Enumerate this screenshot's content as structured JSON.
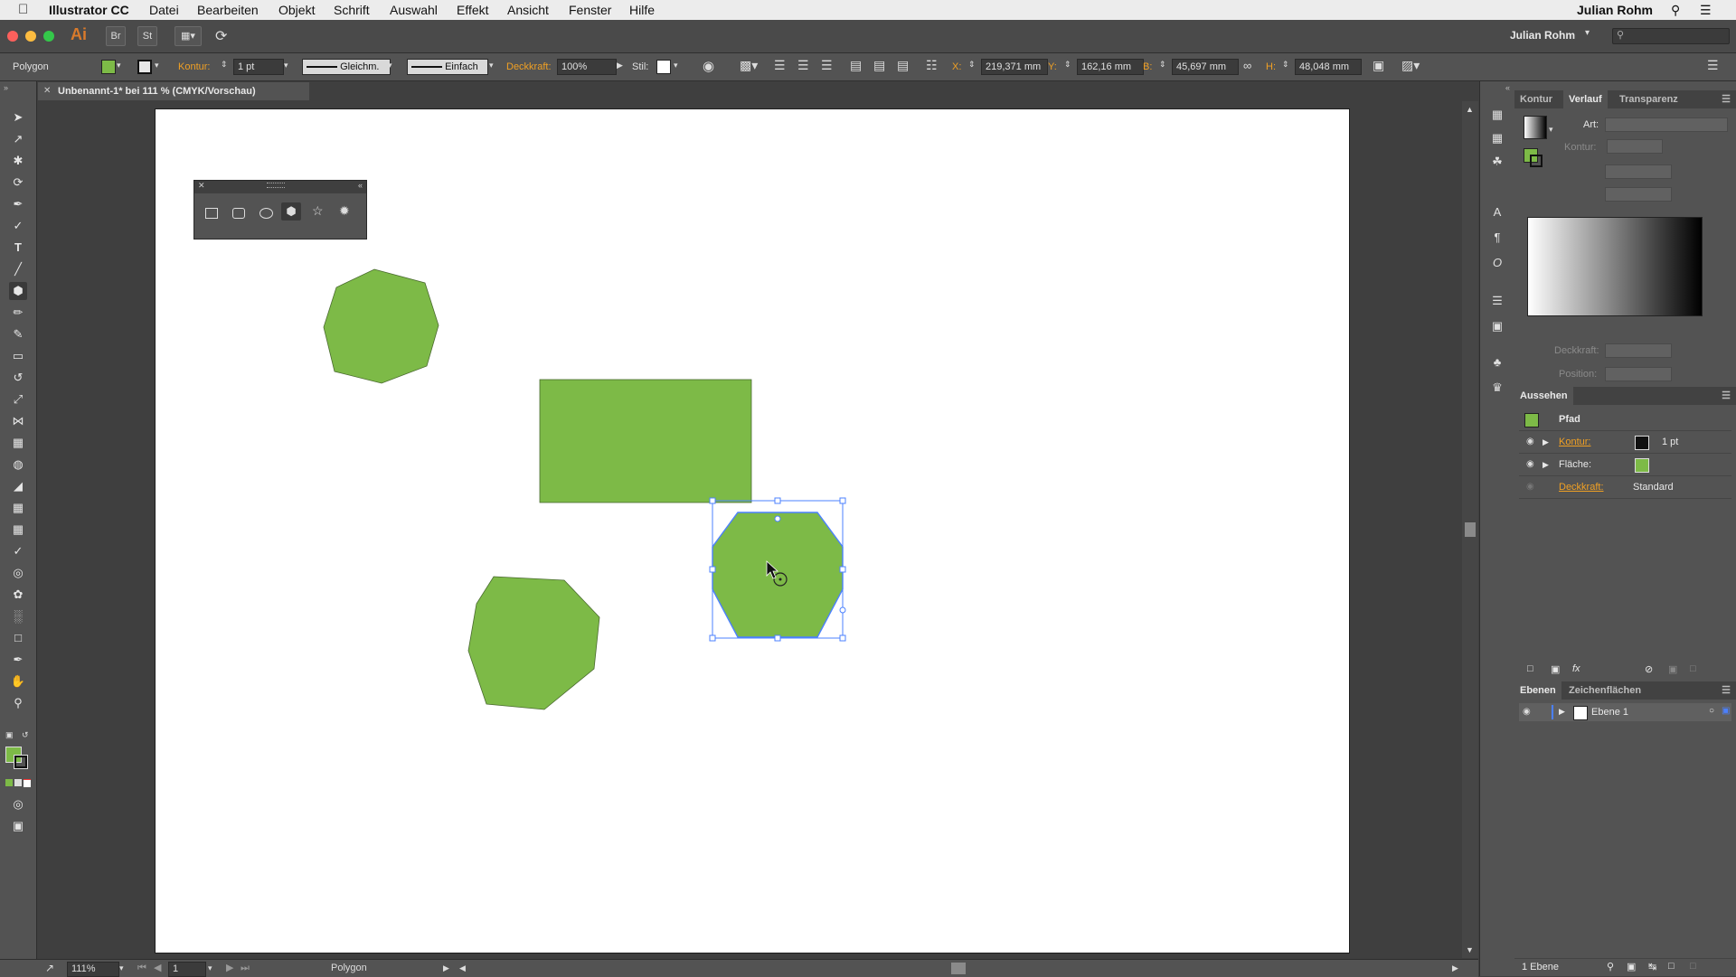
{
  "colors": {
    "fill": "#7dba47",
    "selection": "#4b80ff",
    "accent_label": "#f0a024"
  },
  "menubar": {
    "app": "Illustrator CC",
    "items": [
      "Datei",
      "Bearbeiten",
      "Objekt",
      "Schrift",
      "Auswahl",
      "Effekt",
      "Ansicht",
      "Fenster",
      "Hilfe"
    ],
    "user": "Julian Rohm"
  },
  "appbar": {
    "logo": "Ai",
    "bridge": "Br",
    "stock": "St",
    "workspace": "Julian Rohm",
    "search_placeholder": ""
  },
  "control": {
    "object_type": "Polygon",
    "kontur_label": "Kontur:",
    "kontur_value": "1 pt",
    "stroke_profile": "Gleichm.",
    "brush": "Einfach",
    "opacity_label": "Deckkraft:",
    "opacity_value": "100%",
    "style_label": "Stil:",
    "x_label": "X:",
    "x_value": "219,371 mm",
    "y_label": "Y:",
    "y_value": "162,16 mm",
    "w_label": "B:",
    "w_value": "45,697 mm",
    "h_label": "H:",
    "h_value": "48,048 mm"
  },
  "document": {
    "tab_title": "Unbenannt-1* bei 111 % (CMYK/Vorschau)"
  },
  "status": {
    "zoom": "111%",
    "artboard": "1",
    "tool_name": "Polygon"
  },
  "panels": {
    "gradient": {
      "tabs": [
        "Kontur",
        "Verlauf",
        "Transparenz"
      ],
      "type_label": "Art:",
      "stroke_label": "Kontur:",
      "opacity_label": "Deckkraft:",
      "position_label": "Position:"
    },
    "appearance": {
      "title": "Aussehen",
      "object": "Pfad",
      "rows": [
        {
          "label": "Kontur:",
          "value": "1 pt"
        },
        {
          "label": "Fläche:",
          "value": ""
        },
        {
          "label": "Deckkraft:",
          "value": "Standard"
        }
      ]
    },
    "layers": {
      "tabs": [
        "Ebenen",
        "Zeichenflächen"
      ],
      "layer_name": "Ebene 1",
      "footer": "1 Ebene"
    }
  },
  "tools": [
    "selection-icon",
    "direct-selection-icon",
    "magic-wand-icon",
    "lasso-icon",
    "pen-icon",
    "curvature-icon",
    "type-icon",
    "line-icon",
    "polygon-icon",
    "paintbrush-icon",
    "blob-brush-icon",
    "eraser-icon",
    "rotate-icon",
    "scale-icon",
    "width-icon",
    "free-transform-icon",
    "shape-builder-icon",
    "perspective-icon",
    "mesh-icon",
    "gradient-icon",
    "eyedropper-icon",
    "blend-icon",
    "symbol-sprayer-icon",
    "column-graph-icon",
    "artboard-icon",
    "slice-icon",
    "hand-icon",
    "zoom-icon"
  ]
}
